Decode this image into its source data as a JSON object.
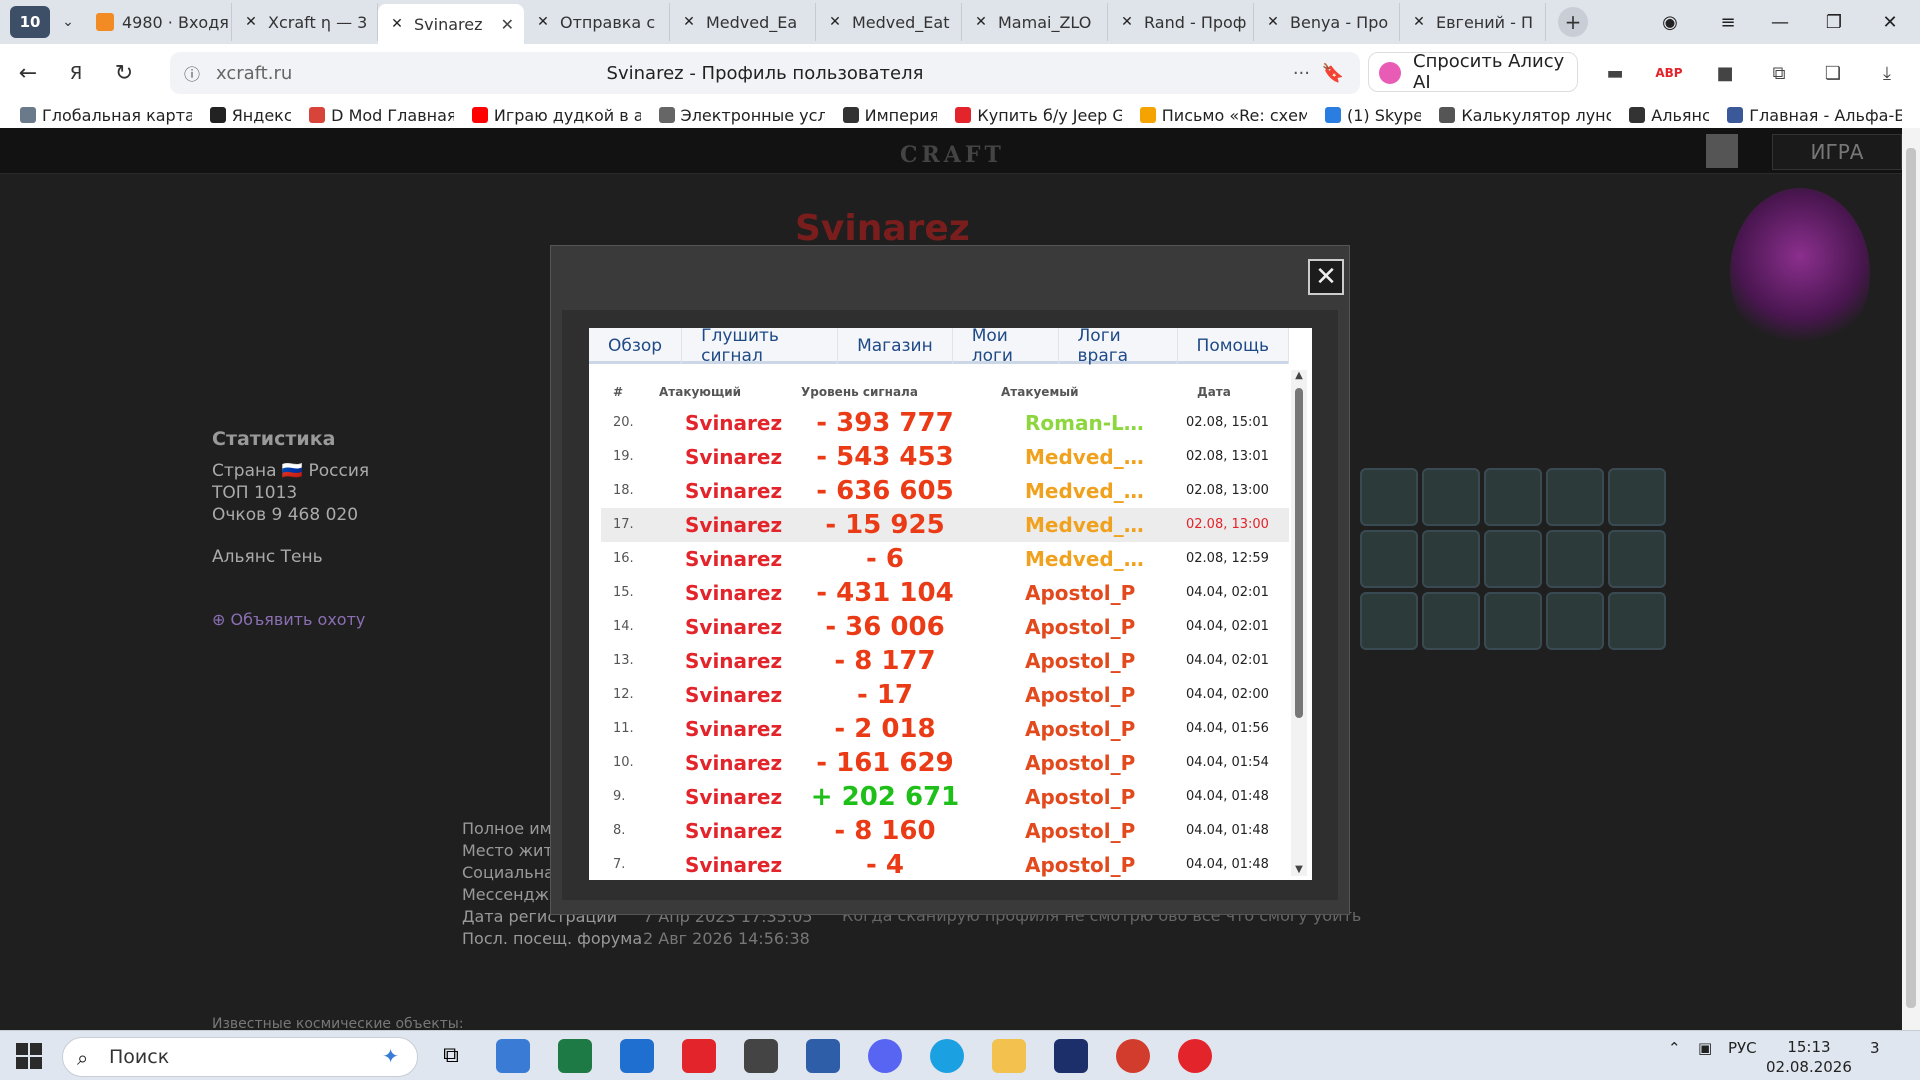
{
  "browser": {
    "tab_counter": "10",
    "tabs": [
      {
        "label": "4980 · Входя",
        "icon": "mail-icon"
      },
      {
        "label": "Xcraft η — 3",
        "icon": "xcraft-icon"
      },
      {
        "label": "Svinarez",
        "icon": "xcraft-icon",
        "active": true
      },
      {
        "label": "Отправка с",
        "icon": "xcraft-icon"
      },
      {
        "label": "Medved_Ea",
        "icon": "xcraft-icon"
      },
      {
        "label": "Medved_Eat",
        "icon": "xcraft-icon"
      },
      {
        "label": "Mamai_ZLO",
        "icon": "xcraft-icon"
      },
      {
        "label": "Rand - Проф",
        "icon": "xcraft-icon"
      },
      {
        "label": "Benya - Про",
        "icon": "xcraft-icon"
      },
      {
        "label": "Евгений - П",
        "icon": "xcraft-icon"
      }
    ],
    "url": "xcraft.ru",
    "page_title": "Svinarez - Профиль пользователя",
    "alice_label": "Спросить Алису AI",
    "bookmarks": [
      {
        "label": "Глобальная карта"
      },
      {
        "label": "Яндекс"
      },
      {
        "label": "D Mod Главная"
      },
      {
        "label": "Играю дудкой в а"
      },
      {
        "label": "Электронные усл"
      },
      {
        "label": "Империя"
      },
      {
        "label": "Купить б/у Jeep G"
      },
      {
        "label": "Письмо «Re: схем"
      },
      {
        "label": "(1) Skype"
      },
      {
        "label": "Калькулятор лунс"
      },
      {
        "label": "Альянс"
      },
      {
        "label": "Главная - Альфа-Б"
      }
    ]
  },
  "site": {
    "logo": "CRAFT",
    "game_button": "ИГРА",
    "profile_name": "Svinarez",
    "stats": {
      "title": "Статистика",
      "country": "Страна 🇷🇺 Россия",
      "top": "ТОП 1013",
      "points": "Очков 9 468 020",
      "alliance": "Альянс Тень"
    },
    "hunt": "⊕ Объявить охоту",
    "info_labels": [
      "Полное им",
      "Место жите",
      "Социальна",
      "Мессендж",
      "Дата регистрации",
      "Посл. посещ. форума"
    ],
    "info_values": [
      "7 Апр 2023 17:35:05",
      "2 Авг 2026 14:56:38"
    ],
    "info_note": "Когда сканирую профиля не смотрю ово все что смогу убить",
    "footer_text": "Известные космические объекты:"
  },
  "modal": {
    "tabs": [
      "Обзор",
      "Глушить сигнал",
      "Магазин",
      "Мои логи",
      "Логи врага",
      "Помощь"
    ],
    "headers": {
      "num": "#",
      "attacker": "Атакующий",
      "signal": "Уровень сигнала",
      "target": "Атакуемый",
      "date": "Дата"
    },
    "rows": [
      {
        "num": "20.",
        "attacker": "Svinarez",
        "signal": "- 393 777",
        "target": "Roman-Lions",
        "date": "02.08, 15:01"
      },
      {
        "num": "19.",
        "attacker": "Svinarez",
        "signal": "- 543 453",
        "target": "Medved_Ea...",
        "date": "02.08, 13:01"
      },
      {
        "num": "18.",
        "attacker": "Svinarez",
        "signal": "- 636 605",
        "target": "Medved_Ea...",
        "date": "02.08, 13:00"
      },
      {
        "num": "17.",
        "attacker": "Svinarez",
        "signal": "- 15 925",
        "target": "Medved_Ea...",
        "date": "02.08, 13:00"
      },
      {
        "num": "16.",
        "attacker": "Svinarez",
        "signal": "- 6",
        "target": "Medved_Ea...",
        "date": "02.08, 12:59"
      },
      {
        "num": "15.",
        "attacker": "Svinarez",
        "signal": "- 431 104",
        "target": "Apostol_P",
        "date": "04.04, 02:01"
      },
      {
        "num": "14.",
        "attacker": "Svinarez",
        "signal": "- 36 006",
        "target": "Apostol_P",
        "date": "04.04, 02:01"
      },
      {
        "num": "13.",
        "attacker": "Svinarez",
        "signal": "- 8 177",
        "target": "Apostol_P",
        "date": "04.04, 02:01"
      },
      {
        "num": "12.",
        "attacker": "Svinarez",
        "signal": "- 17",
        "target": "Apostol_P",
        "date": "04.04, 02:00"
      },
      {
        "num": "11.",
        "attacker": "Svinarez",
        "signal": "- 2 018",
        "target": "Apostol_P",
        "date": "04.04, 01:56"
      },
      {
        "num": "10.",
        "attacker": "Svinarez",
        "signal": "- 161 629",
        "target": "Apostol_P",
        "date": "04.04, 01:54"
      },
      {
        "num": "9.",
        "attacker": "Svinarez",
        "signal": "+ 202 671",
        "target": "Apostol_P",
        "date": "04.04, 01:48"
      },
      {
        "num": "8.",
        "attacker": "Svinarez",
        "signal": "- 8 160",
        "target": "Apostol_P",
        "date": "04.04, 01:48"
      },
      {
        "num": "7.",
        "attacker": "Svinarez",
        "signal": "- 4",
        "target": "Apostol_P",
        "date": "04.04, 01:48"
      }
    ]
  },
  "taskbar": {
    "search": "Поиск",
    "lang": "РУС",
    "time": "15:13",
    "date": "02.08.2026",
    "notif_count": "3"
  }
}
